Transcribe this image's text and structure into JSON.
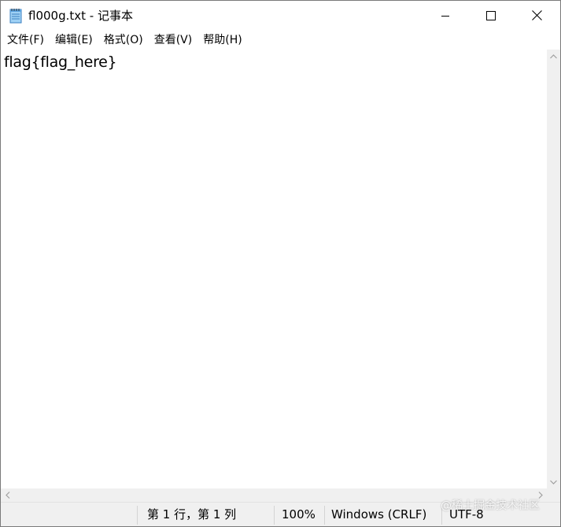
{
  "window": {
    "title": "fl000g.txt - 记事本",
    "app_icon": "notepad-icon"
  },
  "caption_buttons": {
    "minimize_icon": "minimize-icon",
    "maximize_icon": "maximize-icon",
    "close_icon": "close-icon"
  },
  "menu": {
    "items": [
      {
        "label": "文件(F)"
      },
      {
        "label": "编辑(E)"
      },
      {
        "label": "格式(O)"
      },
      {
        "label": "查看(V)"
      },
      {
        "label": "帮助(H)"
      }
    ]
  },
  "editor": {
    "content": "flag{flag_here}"
  },
  "status": {
    "position": "第 1 行，第 1 列",
    "zoom": "100%",
    "line_ending": "Windows (CRLF)",
    "encoding": "UTF-8"
  },
  "watermark": {
    "text": "@稀土掘金技术社区"
  }
}
